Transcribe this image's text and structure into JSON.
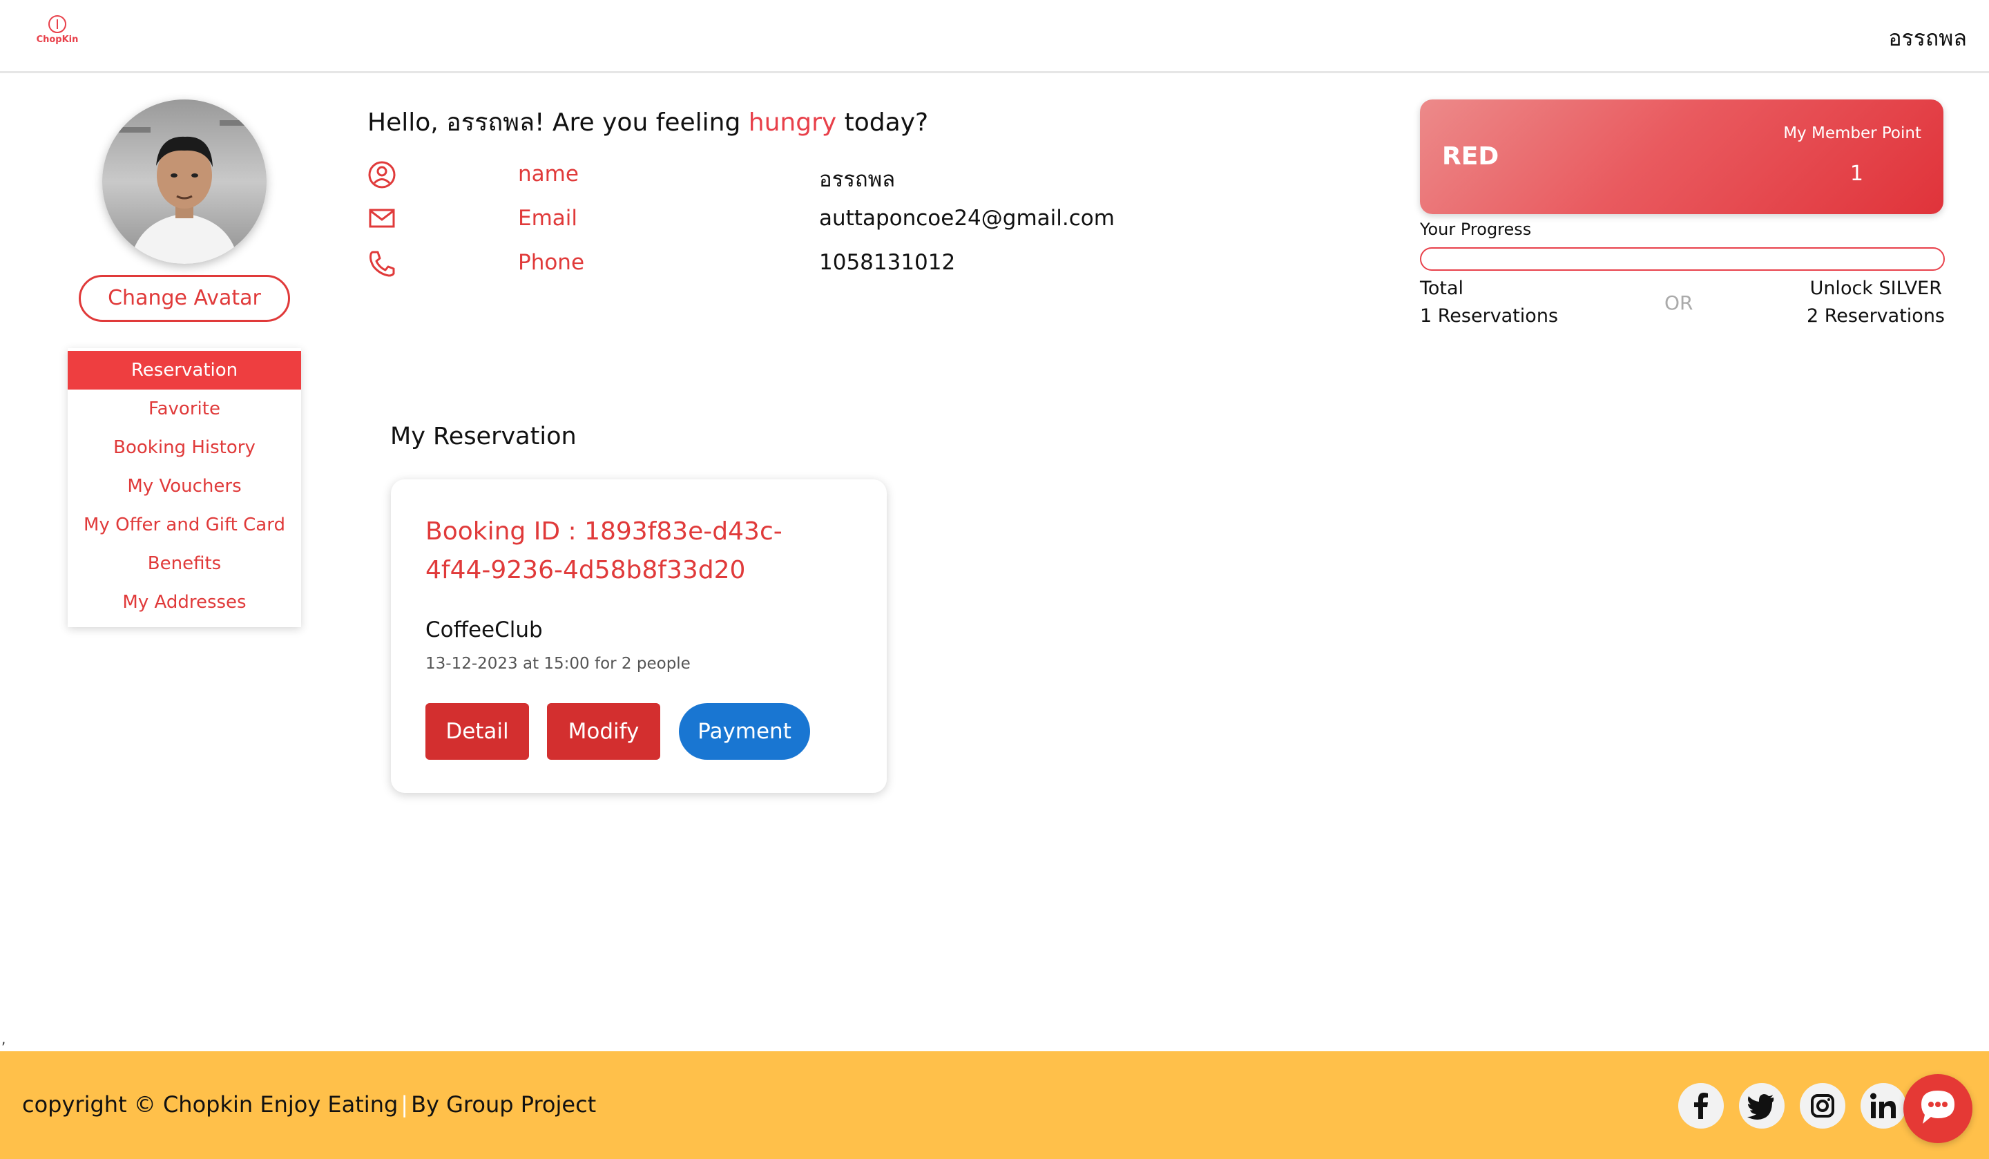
{
  "header": {
    "logo_text": "ChopKin",
    "user_name": "อรรถพล"
  },
  "sidebar": {
    "change_avatar_label": "Change Avatar",
    "items": [
      {
        "label": "Reservation",
        "active": true
      },
      {
        "label": "Favorite"
      },
      {
        "label": "Booking History"
      },
      {
        "label": "My Vouchers"
      },
      {
        "label": "My Offer and Gift Card"
      },
      {
        "label": "Benefits"
      },
      {
        "label": "My Addresses"
      }
    ]
  },
  "greeting": {
    "before": "Hello, อรรถพล! Are you feeling ",
    "highlight": "hungry",
    "after": " today?"
  },
  "profile": {
    "name_label": "name",
    "name_value": "อรรถพล",
    "email_label": "Email",
    "email_value": "auttaponcoe24@gmail.com",
    "phone_label": "Phone",
    "phone_value": "1058131012"
  },
  "membership": {
    "tier": "RED",
    "points_label": "My Member Point",
    "points": "1",
    "progress_label": "Your Progress",
    "progress_fraction": 0,
    "total_label": "Total",
    "total_value": "1 Reservations",
    "or_label": "OR",
    "unlock_label": "Unlock SILVER",
    "unlock_value": "2 Reservations"
  },
  "reservations": {
    "title": "My Reservation",
    "items": [
      {
        "booking_id": "Booking ID : 1893f83e-d43c-4f44-9236-4d58b8f33d20",
        "restaurant": "CoffeeClub",
        "meta": "13-12-2023 at 15:00 for 2 people",
        "detail_label": "Detail",
        "modify_label": "Modify",
        "payment_label": "Payment"
      }
    ]
  },
  "stray_text": ",",
  "footer": {
    "copyright": "copyright © Chopkin Enjoy Eating",
    "separator": "|",
    "byline": "By Group Project",
    "social": [
      "facebook-icon",
      "twitter-icon",
      "instagram-icon",
      "linkedin-icon"
    ],
    "chat_icon": "chat-bubble-icon"
  },
  "colors": {
    "accent_red": "#e8404a",
    "button_red": "#d32f2f",
    "button_blue": "#1976d2",
    "footer_yellow": "#ffc04a"
  }
}
